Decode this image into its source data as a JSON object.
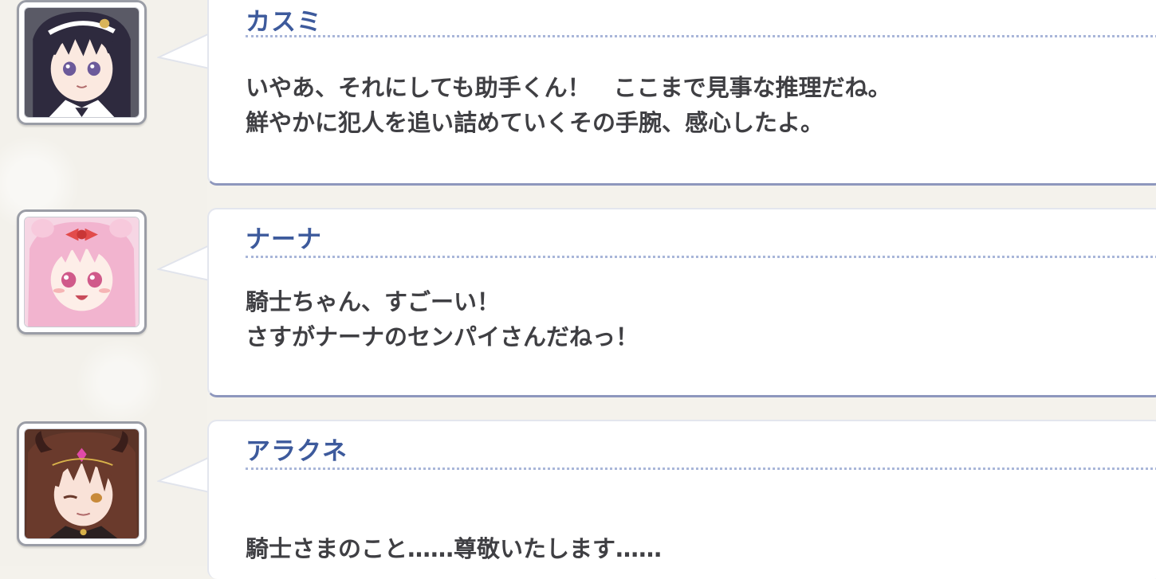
{
  "dialogue": [
    {
      "speaker": "カスミ",
      "avatar_icon": "kasumi-portrait-icon",
      "line1": "いやあ、それにしても助手くん！　ここまで見事な推理だね。",
      "line2": "鮮やかに犯人を追い詰めていくその手腕、感心したよ。"
    },
    {
      "speaker": "ナーナ",
      "avatar_icon": "nana-portrait-icon",
      "line1": "騎士ちゃん、すごーい！",
      "line2": "さすがナーナのセンパイさんだねっ！"
    },
    {
      "speaker": "アラクネ",
      "avatar_icon": "arachne-portrait-icon",
      "line1": "",
      "line2": "騎士さまのこと……尊敬いたします……"
    }
  ],
  "colors": {
    "speaker_name": "#3d5a9c",
    "message_text": "#3f3f43",
    "bubble_bottom_border": "#8e97bd",
    "background": "#f4f2ec"
  }
}
